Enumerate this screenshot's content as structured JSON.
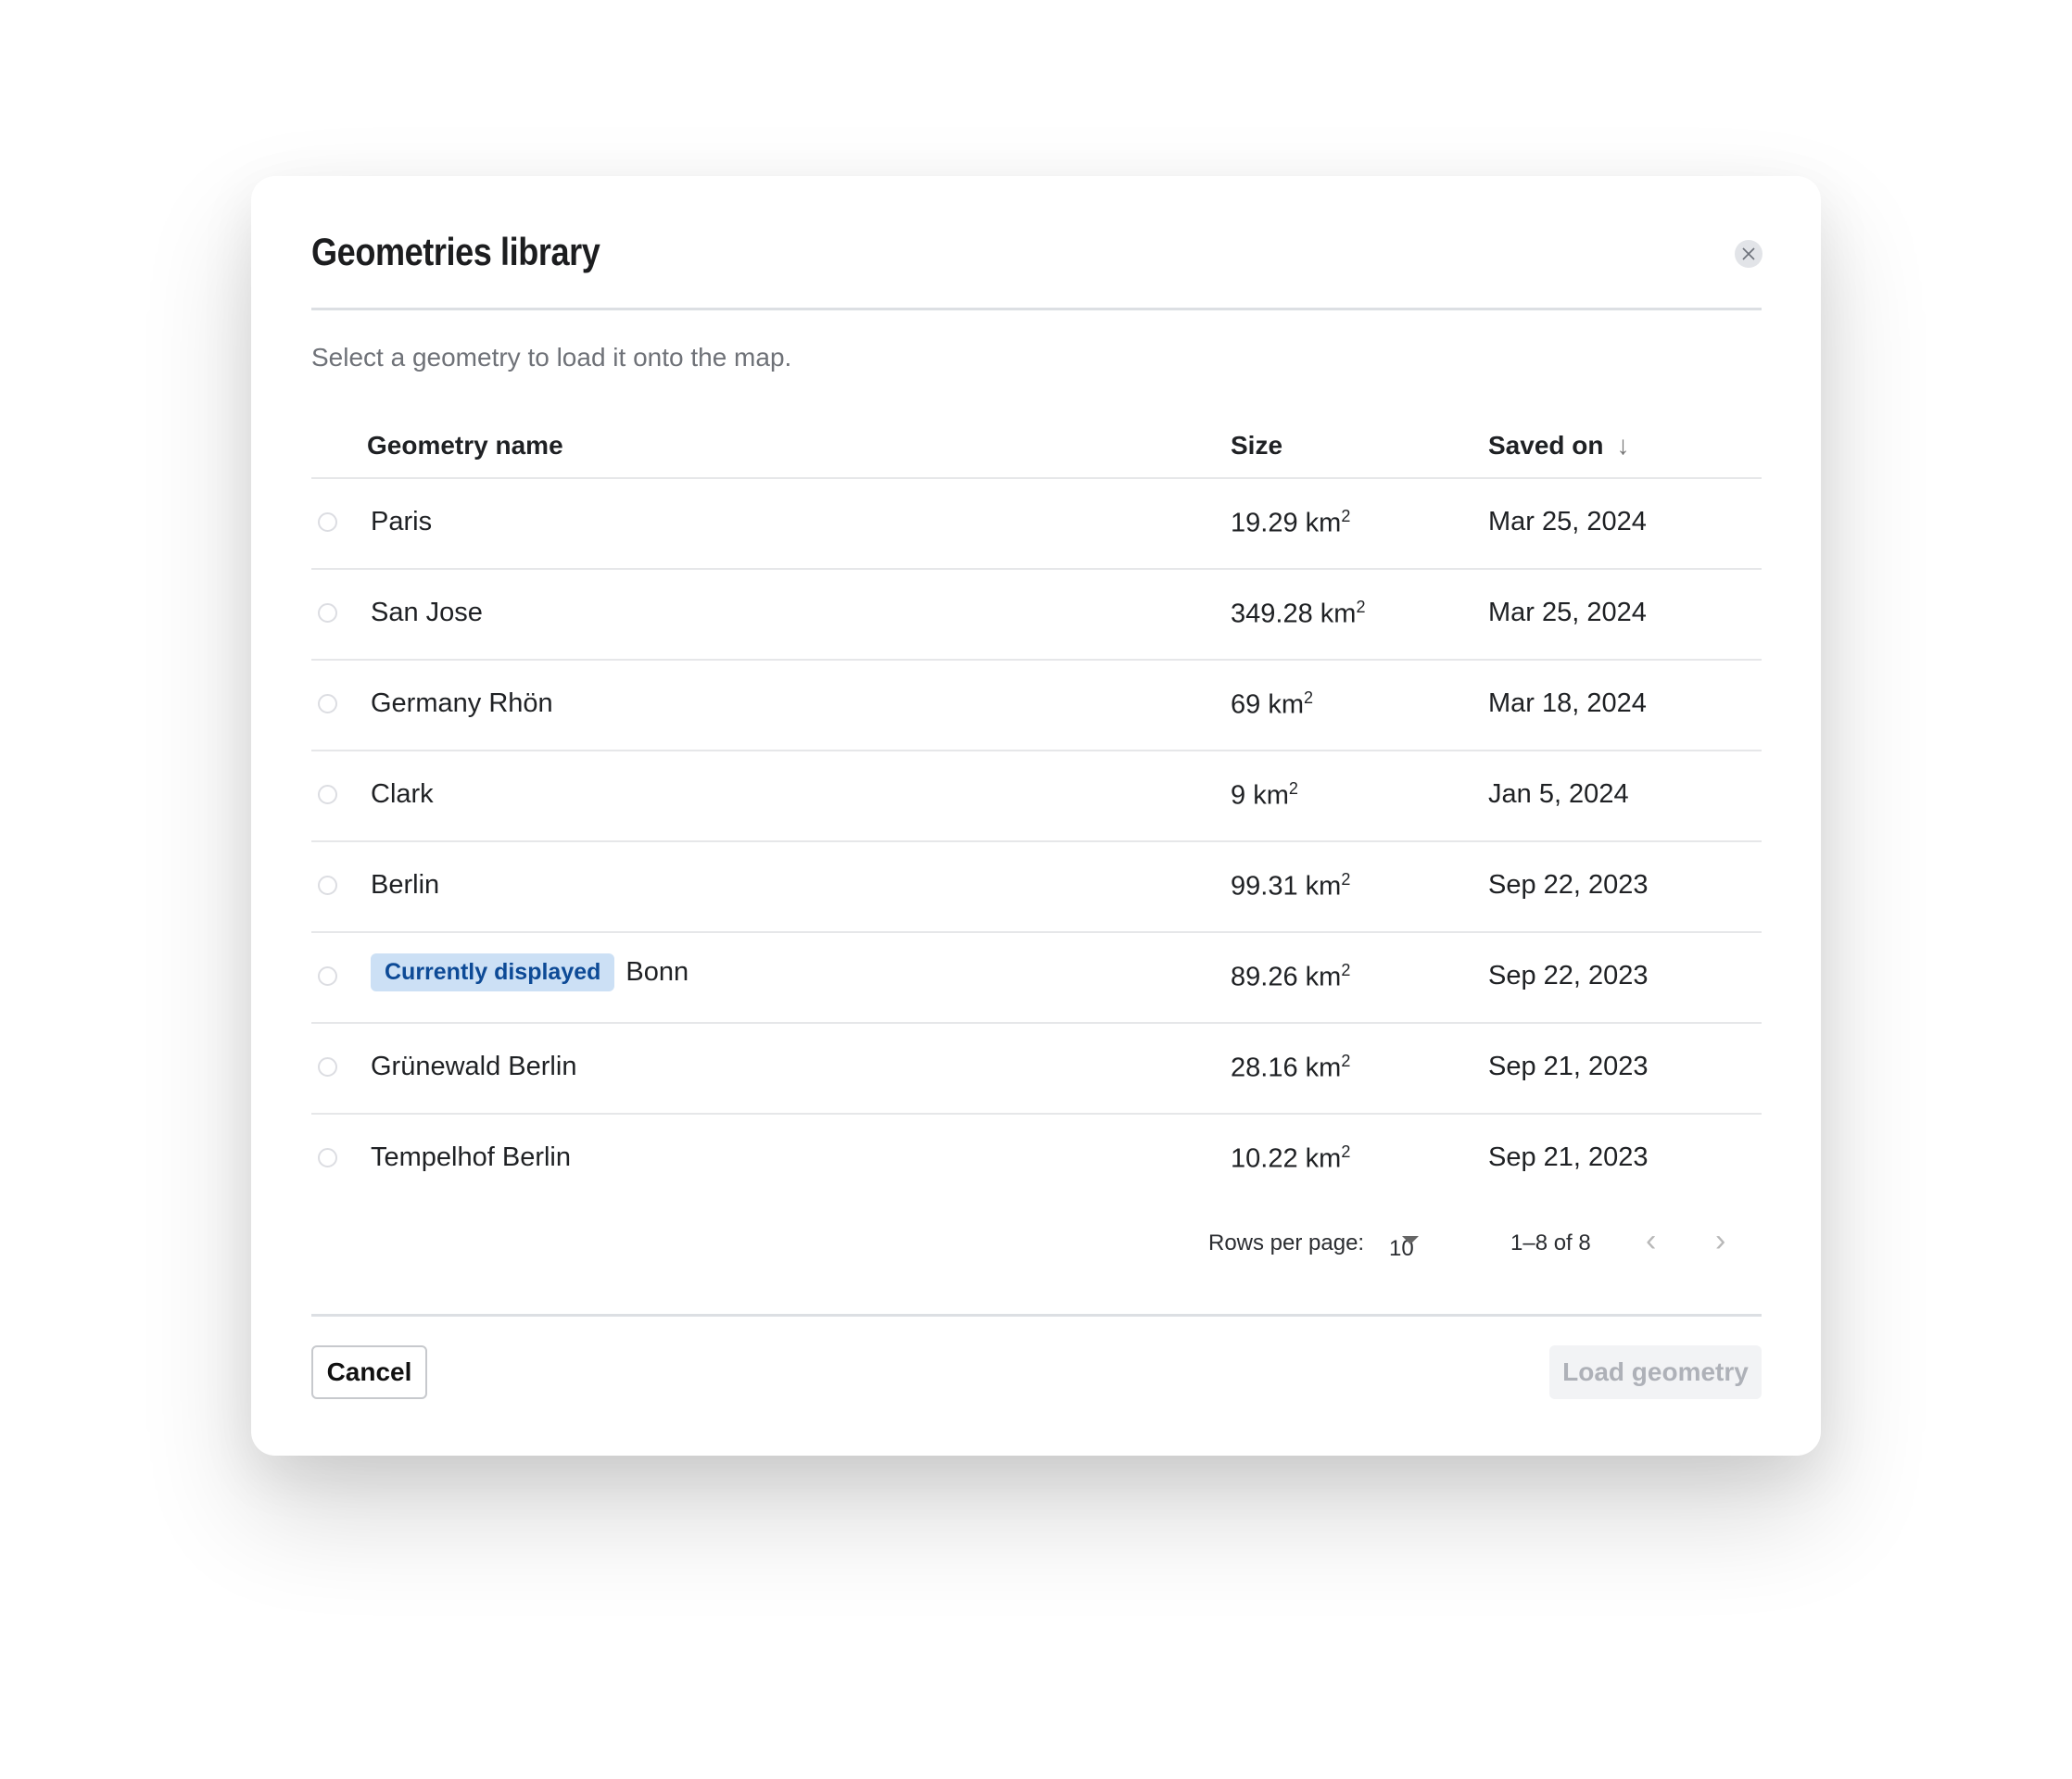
{
  "dialog": {
    "title": "Geometries library",
    "subtitle": "Select a geometry to load it onto the map.",
    "close_icon": "close-icon"
  },
  "table": {
    "columns": [
      "Geometry name",
      "Size",
      "Saved on"
    ],
    "sort": {
      "column": "Saved on",
      "direction": "descending",
      "icon": "arrow-down-icon",
      "glyph": "↓"
    },
    "unit_suffix": "km",
    "unit_power": "2",
    "rows": [
      {
        "name": "Paris",
        "size": "19.29",
        "saved_on": "Mar 25, 2024",
        "badge": null
      },
      {
        "name": "San Jose",
        "size": "349.28",
        "saved_on": "Mar 25, 2024",
        "badge": null
      },
      {
        "name": "Germany Rhön",
        "size": "69",
        "saved_on": "Mar 18, 2024",
        "badge": null
      },
      {
        "name": "Clark",
        "size": "9",
        "saved_on": "Jan 5, 2024",
        "badge": null
      },
      {
        "name": "Berlin",
        "size": "99.31",
        "saved_on": "Sep 22, 2023",
        "badge": null
      },
      {
        "name": "Bonn",
        "size": "89.26",
        "saved_on": "Sep 22, 2023",
        "badge": "Currently displayed"
      },
      {
        "name": "Grünewald Berlin",
        "size": "28.16",
        "saved_on": "Sep 21, 2023",
        "badge": null
      },
      {
        "name": "Tempelhof Berlin",
        "size": "10.22",
        "saved_on": "Sep 21, 2023",
        "badge": null
      }
    ]
  },
  "pagination": {
    "rows_per_page_label": "Rows per page:",
    "rows_per_page_value": "10",
    "range": "1–8 of 8",
    "prev_glyph": "‹",
    "next_glyph": "›"
  },
  "footer": {
    "cancel_label": "Cancel",
    "load_label": "Load geometry"
  },
  "colors": {
    "badge_bg": "#cce0f5",
    "badge_text": "#0d4a96",
    "disabled_text": "#aeb1b8"
  }
}
